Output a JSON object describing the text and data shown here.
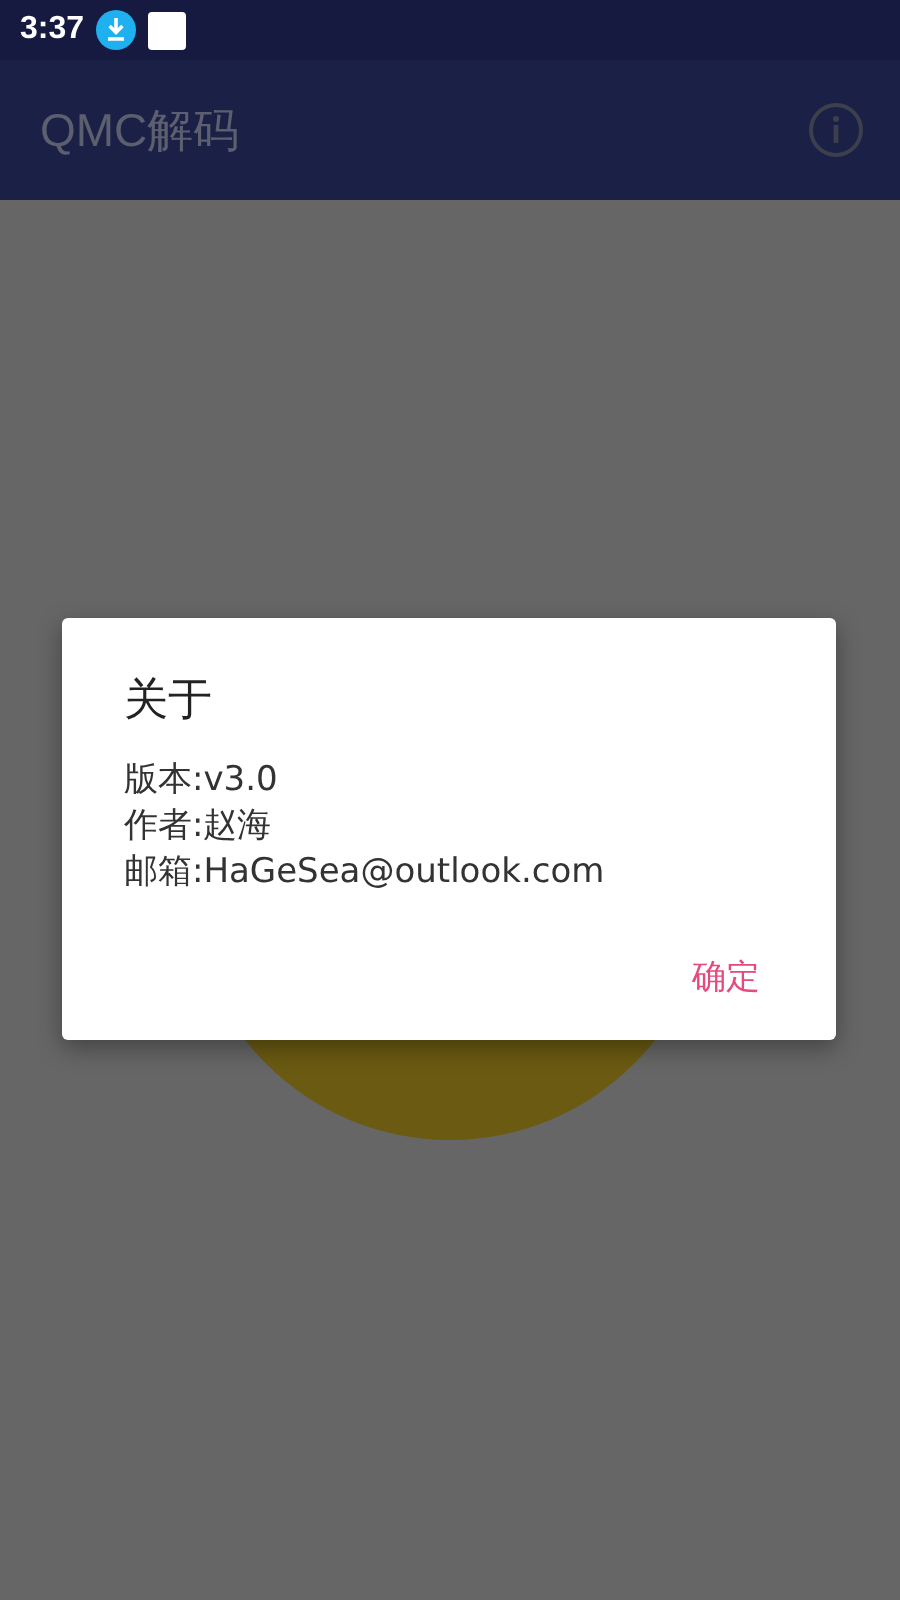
{
  "status_bar": {
    "time": "3:37"
  },
  "app_bar": {
    "title": "QMC解码"
  },
  "dialog": {
    "title": "关于",
    "lines": [
      "版本:v3.0",
      "作者:赵海",
      "邮箱:HaGeSea@outlook.com"
    ],
    "buttons": [
      "确定"
    ]
  }
}
